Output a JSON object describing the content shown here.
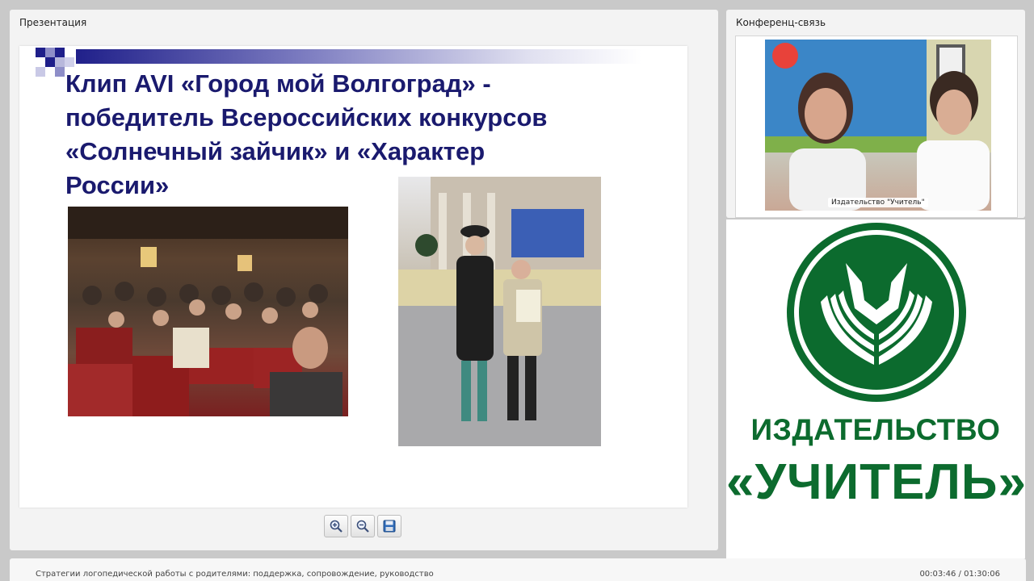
{
  "presentation": {
    "title": "Презентация",
    "slide": {
      "heading_lines": [
        "Клип AVI «Город мой Волгоград» -",
        "победитель Всероссийских конкурсов",
        "«Солнечный зайчик» и «Характер",
        "России»"
      ]
    },
    "controls": {
      "zoom_in_icon": "magnifier-plus-icon",
      "zoom_out_icon": "magnifier-minus-icon",
      "save_icon": "floppy-disk-icon"
    }
  },
  "conference": {
    "title": "Конференц-связь",
    "speaker_label": "Издательство \"Учитель\""
  },
  "logo": {
    "line1": "ИЗДАТЕЛЬСТВО",
    "line2": "«УЧИТЕЛЬ»",
    "brand_color": "#0c6b2e"
  },
  "footer": {
    "webinar_title": "Стратегии логопедической работы с родителями: поддержка, сопровождение, руководство",
    "time": "00:03:46 / 01:30:06"
  }
}
